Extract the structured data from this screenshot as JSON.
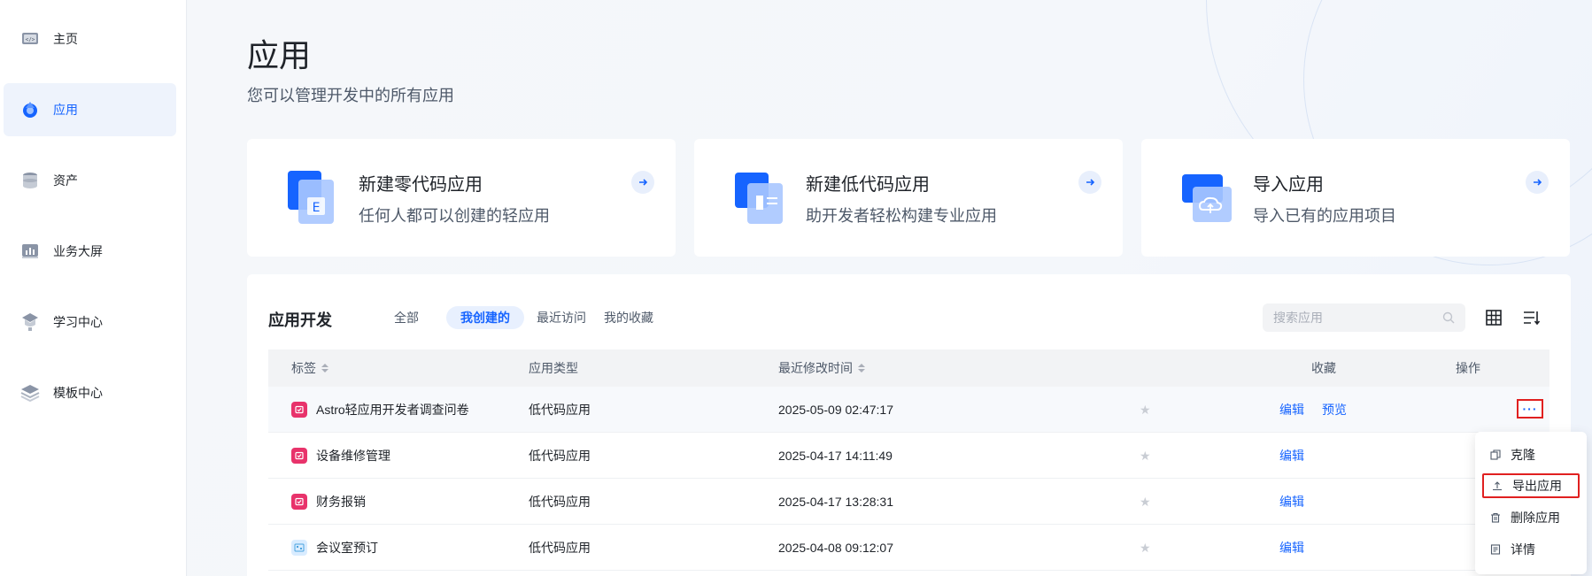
{
  "sidebar": {
    "items": [
      {
        "label": "主页",
        "icon": "code-icon"
      },
      {
        "label": "应用",
        "icon": "app-icon"
      },
      {
        "label": "资产",
        "icon": "database-icon"
      },
      {
        "label": "业务大屏",
        "icon": "chart-screen-icon"
      },
      {
        "label": "学习中心",
        "icon": "learning-icon"
      },
      {
        "label": "模板中心",
        "icon": "layers-icon"
      }
    ],
    "active_index": 1
  },
  "header": {
    "title": "应用",
    "subtitle": "您可以管理开发中的所有应用"
  },
  "cards": [
    {
      "title": "新建零代码应用",
      "desc": "任何人都可以创建的轻应用",
      "icon": "zero-code-icon"
    },
    {
      "title": "新建低代码应用",
      "desc": "助开发者轻松构建专业应用",
      "icon": "low-code-icon"
    },
    {
      "title": "导入应用",
      "desc": "导入已有的应用项目",
      "icon": "cloud-upload-icon"
    }
  ],
  "panel": {
    "title": "应用开发",
    "tabs": [
      "全部",
      "我创建的",
      "最近访问",
      "我的收藏"
    ],
    "active_tab": 1,
    "search_placeholder": "搜索应用"
  },
  "table": {
    "headers": {
      "tag": "标签",
      "type": "应用类型",
      "modified": "最近修改时间",
      "favorite": "收藏",
      "actions": "操作"
    },
    "rows": [
      {
        "name": "Astro轻应用开发者调查问卷",
        "type": "低代码应用",
        "modified": "2025-05-09 02:47:17",
        "edit": "编辑",
        "preview": "预览",
        "icon_color": "#e8336b"
      },
      {
        "name": "设备维修管理",
        "type": "低代码应用",
        "modified": "2025-04-17 14:11:49",
        "edit": "编辑",
        "icon_color": "#e8336b"
      },
      {
        "name": "财务报销",
        "type": "低代码应用",
        "modified": "2025-04-17 13:28:31",
        "edit": "编辑",
        "icon_color": "#e8336b"
      },
      {
        "name": "会议室预订",
        "type": "低代码应用",
        "modified": "2025-04-08 09:12:07",
        "edit": "编辑",
        "icon_color": "#d9ecff"
      }
    ]
  },
  "more_menu": {
    "more_label": "···",
    "items": [
      {
        "label": "克隆",
        "icon": "clone-icon"
      },
      {
        "label": "导出应用",
        "icon": "export-icon"
      },
      {
        "label": "删除应用",
        "icon": "trash-icon"
      },
      {
        "label": "详情",
        "icon": "detail-icon"
      }
    ]
  },
  "colors": {
    "accent": "#1664ff",
    "highlight_border": "#e02020"
  }
}
